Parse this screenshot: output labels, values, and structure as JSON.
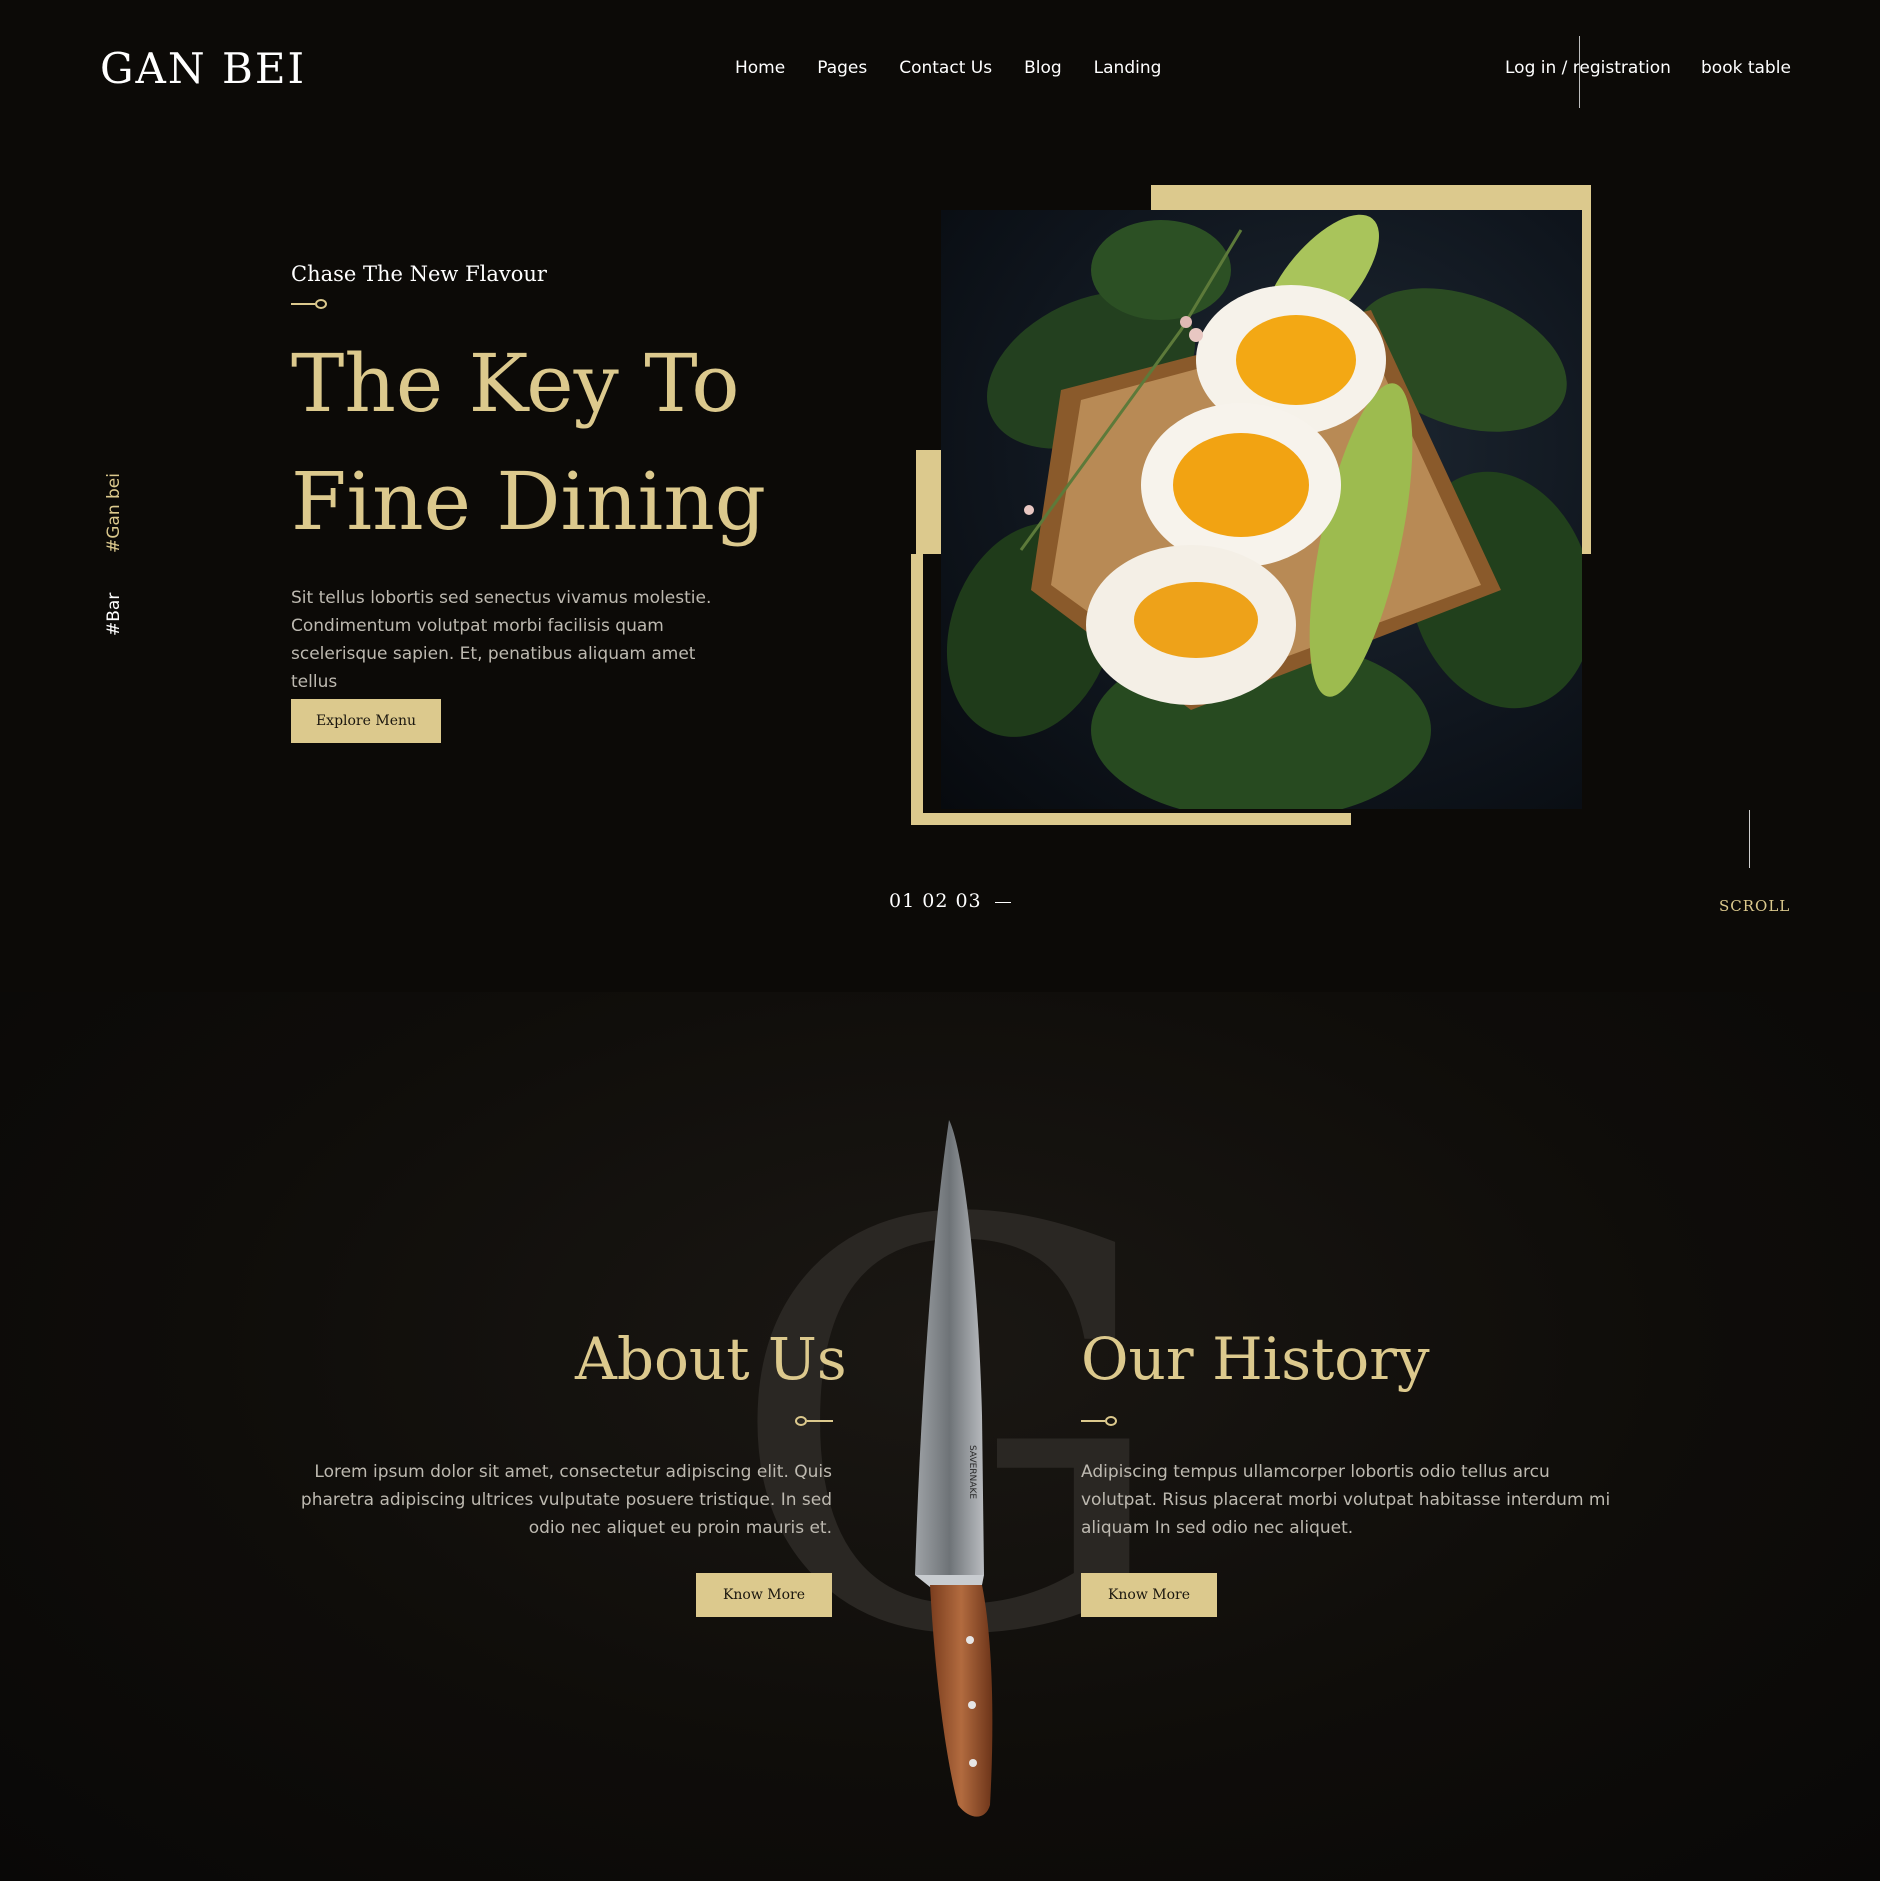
{
  "header": {
    "logo": "GAN BEI",
    "nav": [
      "Home",
      "Pages",
      "Contact Us",
      "Blog",
      "Landing"
    ],
    "login": "Log in / registration",
    "book": "book table"
  },
  "side_tags": [
    "#Gan bei",
    "#Bar"
  ],
  "hero": {
    "kicker": "Chase The New Flavour",
    "title_line1": "The Key To",
    "title_line2": "Fine Dining",
    "description": "Sit tellus lobortis sed senectus vivamus molestie. Condimentum volutpat morbi facilisis quam scelerisque sapien. Et, penatibus aliquam amet tellus",
    "button": "Explore Menu",
    "slides": [
      "01",
      "02",
      "03"
    ],
    "scroll": "SCROLL"
  },
  "about": {
    "watermark": "G",
    "knife_brand": "SAVERNAKE",
    "left": {
      "title": "About Us",
      "text": "Lorem ipsum dolor sit amet, consectetur adipiscing elit. Quis pharetra adipiscing ultrices vulputate posuere tristique. In sed odio nec aliquet eu proin mauris et.",
      "button": "Know More"
    },
    "right": {
      "title": "Our History",
      "text": "Adipiscing tempus ullamcorper lobortis odio tellus arcu volutpat. Risus placerat morbi volutpat habitasse interdum mi aliquam In sed odio nec aliquet.",
      "button": "Know More"
    }
  },
  "colors": {
    "background": "#0c0a07",
    "accent_gold": "#dcc98d",
    "body_text": "#bdb9b0"
  }
}
